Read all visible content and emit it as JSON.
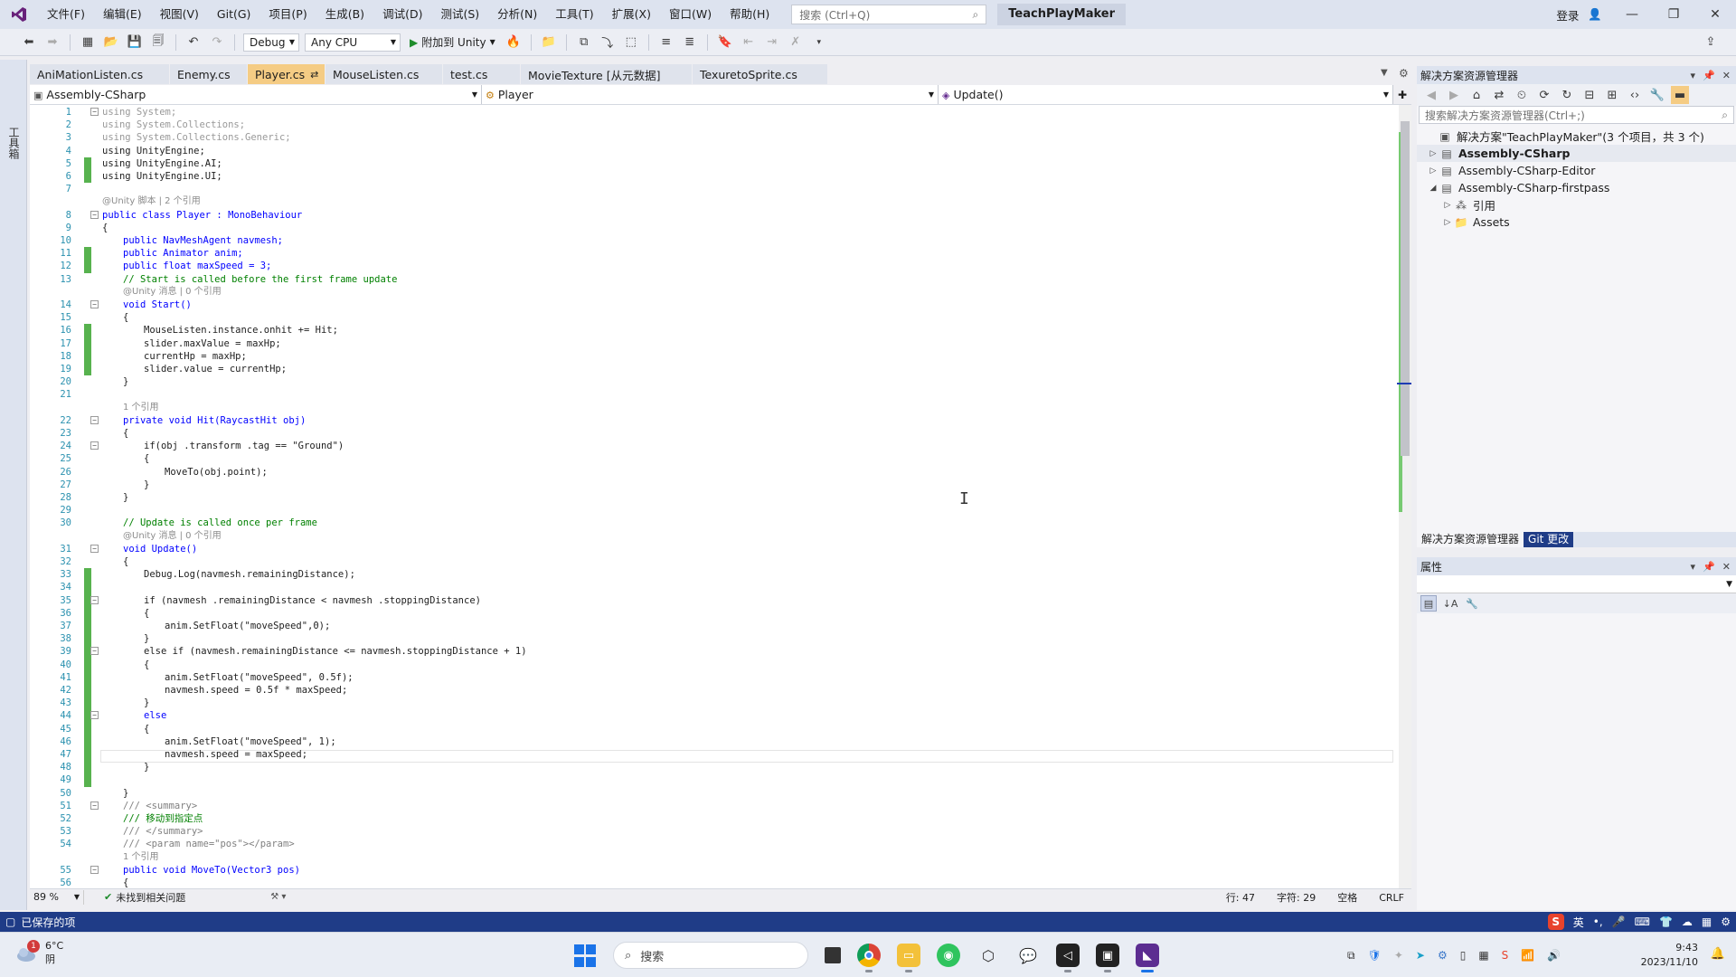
{
  "window": {
    "menus": [
      "文件(F)",
      "编辑(E)",
      "视图(V)",
      "Git(G)",
      "项目(P)",
      "生成(B)",
      "调试(D)",
      "测试(S)",
      "分析(N)",
      "工具(T)",
      "扩展(X)",
      "窗口(W)",
      "帮助(H)"
    ],
    "search_placeholder": "搜索 (Ctrl+Q)",
    "solution_name": "TeachPlayMaker",
    "signin_label": "登录"
  },
  "toolbar": {
    "config": "Debug",
    "platform": "Any CPU",
    "attach_label": "附加到 Unity"
  },
  "left_strip": {
    "toolbox_label": "工具箱"
  },
  "tabs": [
    {
      "label": "AniMationListen.cs",
      "active": false
    },
    {
      "label": "Enemy.cs",
      "active": false
    },
    {
      "label": "Player.cs",
      "active": true
    },
    {
      "label": "MouseListen.cs",
      "active": false
    },
    {
      "label": "test.cs",
      "active": false
    },
    {
      "label": "MovieTexture [从元数据]",
      "active": false
    },
    {
      "label": "TexuretoSprite.cs",
      "active": false
    }
  ],
  "navbar": {
    "project": "Assembly-CSharp",
    "class": "Player",
    "member": "Update()"
  },
  "code_lines": [
    {
      "n": "1",
      "t": "using System;",
      "k": "using",
      "i": 0,
      "f": "minus",
      "c": false
    },
    {
      "n": "2",
      "t": "using System.Collections;",
      "k": "using",
      "i": 0,
      "f": "",
      "c": false
    },
    {
      "n": "3",
      "t": "using System.Collections.Generic;",
      "k": "using",
      "i": 0,
      "f": "",
      "c": false
    },
    {
      "n": "4",
      "t": "using UnityEngine;",
      "k": "code",
      "i": 0,
      "f": "",
      "c": false
    },
    {
      "n": "5",
      "t": "using UnityEngine.AI;",
      "k": "code",
      "i": 0,
      "f": "",
      "c": true
    },
    {
      "n": "6",
      "t": "using UnityEngine.UI;",
      "k": "code",
      "i": 0,
      "f": "",
      "c": true
    },
    {
      "n": "7",
      "t": "",
      "k": "code",
      "i": 0,
      "f": "",
      "c": false
    },
    {
      "n": "",
      "t": "@Unity 脚本 | 2 个引用",
      "k": "lens",
      "i": 0,
      "f": "",
      "c": false
    },
    {
      "n": "8",
      "t": "public class Player : MonoBehaviour",
      "k": "kw",
      "i": 0,
      "f": "minus",
      "c": false
    },
    {
      "n": "9",
      "t": "{",
      "k": "code",
      "i": 0,
      "f": "",
      "c": false
    },
    {
      "n": "10",
      "t": "public NavMeshAgent navmesh;",
      "k": "kw",
      "i": 1,
      "f": "",
      "c": false
    },
    {
      "n": "11",
      "t": "public Animator anim;",
      "k": "kw",
      "i": 1,
      "f": "",
      "c": true
    },
    {
      "n": "12",
      "t": "public float maxSpeed = 3;",
      "k": "kw",
      "i": 1,
      "f": "",
      "c": true
    },
    {
      "n": "13",
      "t": "// Start is called before the first frame update",
      "k": "comment",
      "i": 1,
      "f": "",
      "c": false
    },
    {
      "n": "",
      "t": "@Unity 消息 | 0 个引用",
      "k": "lens",
      "i": 1,
      "f": "",
      "c": false
    },
    {
      "n": "14",
      "t": "void Start()",
      "k": "kw",
      "i": 1,
      "f": "minus",
      "c": false
    },
    {
      "n": "15",
      "t": "{",
      "k": "code",
      "i": 1,
      "f": "",
      "c": false
    },
    {
      "n": "16",
      "t": "MouseListen.instance.onhit += Hit;",
      "k": "code",
      "i": 2,
      "f": "",
      "c": true
    },
    {
      "n": "17",
      "t": "slider.maxValue = maxHp;",
      "k": "code",
      "i": 2,
      "f": "",
      "c": true
    },
    {
      "n": "18",
      "t": "currentHp = maxHp;",
      "k": "code",
      "i": 2,
      "f": "",
      "c": true
    },
    {
      "n": "19",
      "t": "slider.value = currentHp;",
      "k": "code",
      "i": 2,
      "f": "",
      "c": true
    },
    {
      "n": "20",
      "t": "}",
      "k": "code",
      "i": 1,
      "f": "",
      "c": false
    },
    {
      "n": "21",
      "t": "",
      "k": "code",
      "i": 0,
      "f": "",
      "c": false
    },
    {
      "n": "",
      "t": "1 个引用",
      "k": "lens",
      "i": 1,
      "f": "",
      "c": false
    },
    {
      "n": "22",
      "t": "private void Hit(RaycastHit obj)",
      "k": "kw",
      "i": 1,
      "f": "minus",
      "c": false
    },
    {
      "n": "23",
      "t": "{",
      "k": "code",
      "i": 1,
      "f": "",
      "c": false
    },
    {
      "n": "24",
      "t": "if(obj .transform .tag == \"Ground\")",
      "k": "code",
      "i": 2,
      "f": "minus",
      "c": false
    },
    {
      "n": "25",
      "t": "{",
      "k": "code",
      "i": 2,
      "f": "",
      "c": false
    },
    {
      "n": "26",
      "t": "MoveTo(obj.point);",
      "k": "code",
      "i": 3,
      "f": "",
      "c": false
    },
    {
      "n": "27",
      "t": "}",
      "k": "code",
      "i": 2,
      "f": "",
      "c": false
    },
    {
      "n": "28",
      "t": "}",
      "k": "code",
      "i": 1,
      "f": "",
      "c": false
    },
    {
      "n": "29",
      "t": "",
      "k": "code",
      "i": 0,
      "f": "",
      "c": false
    },
    {
      "n": "30",
      "t": "// Update is called once per frame",
      "k": "comment",
      "i": 1,
      "f": "",
      "c": false
    },
    {
      "n": "",
      "t": "@Unity 消息 | 0 个引用",
      "k": "lens",
      "i": 1,
      "f": "",
      "c": false
    },
    {
      "n": "31",
      "t": "void Update()",
      "k": "kw",
      "i": 1,
      "f": "minus",
      "c": false
    },
    {
      "n": "32",
      "t": "{",
      "k": "code",
      "i": 1,
      "f": "",
      "c": false
    },
    {
      "n": "33",
      "t": "Debug.Log(navmesh.remainingDistance);",
      "k": "code",
      "i": 2,
      "f": "",
      "c": true
    },
    {
      "n": "34",
      "t": "",
      "k": "code",
      "i": 0,
      "f": "",
      "c": true
    },
    {
      "n": "35",
      "t": "if (navmesh .remainingDistance < navmesh .stoppingDistance)",
      "k": "code",
      "i": 2,
      "f": "minus",
      "c": true
    },
    {
      "n": "36",
      "t": "{",
      "k": "code",
      "i": 2,
      "f": "",
      "c": true
    },
    {
      "n": "37",
      "t": "anim.SetFloat(\"moveSpeed\",0);",
      "k": "code",
      "i": 3,
      "f": "",
      "c": true
    },
    {
      "n": "38",
      "t": "}",
      "k": "code",
      "i": 2,
      "f": "",
      "c": true
    },
    {
      "n": "39",
      "t": "else if (navmesh.remainingDistance <= navmesh.stoppingDistance + 1)",
      "k": "code",
      "i": 2,
      "f": "minus",
      "c": true
    },
    {
      "n": "40",
      "t": "{",
      "k": "code",
      "i": 2,
      "f": "",
      "c": true
    },
    {
      "n": "41",
      "t": "anim.SetFloat(\"moveSpeed\", 0.5f);",
      "k": "code",
      "i": 3,
      "f": "",
      "c": true
    },
    {
      "n": "42",
      "t": "navmesh.speed = 0.5f * maxSpeed;",
      "k": "code",
      "i": 3,
      "f": "",
      "c": true
    },
    {
      "n": "43",
      "t": "}",
      "k": "code",
      "i": 2,
      "f": "",
      "c": true
    },
    {
      "n": "44",
      "t": "else",
      "k": "kw",
      "i": 2,
      "f": "minus",
      "c": true
    },
    {
      "n": "45",
      "t": "{",
      "k": "code",
      "i": 2,
      "f": "",
      "c": true
    },
    {
      "n": "46",
      "t": "anim.SetFloat(\"moveSpeed\", 1);",
      "k": "code",
      "i": 3,
      "f": "",
      "c": true
    },
    {
      "n": "47",
      "t": "navmesh.speed = maxSpeed;",
      "k": "code",
      "i": 3,
      "f": "",
      "c": true
    },
    {
      "n": "48",
      "t": "}",
      "k": "code",
      "i": 2,
      "f": "",
      "c": true
    },
    {
      "n": "49",
      "t": "",
      "k": "code",
      "i": 0,
      "f": "",
      "c": true
    },
    {
      "n": "50",
      "t": "}",
      "k": "code",
      "i": 1,
      "f": "",
      "c": false
    },
    {
      "n": "51",
      "t": "/// <summary>",
      "k": "doc",
      "i": 1,
      "f": "minus",
      "c": false
    },
    {
      "n": "52",
      "t": "/// 移动到指定点",
      "k": "docgreen",
      "i": 1,
      "f": "",
      "c": false
    },
    {
      "n": "53",
      "t": "/// </summary>",
      "k": "doc",
      "i": 1,
      "f": "",
      "c": false
    },
    {
      "n": "54",
      "t": "/// <param name=\"pos\"></param>",
      "k": "doc",
      "i": 1,
      "f": "",
      "c": false
    },
    {
      "n": "",
      "t": "1 个引用",
      "k": "lens",
      "i": 1,
      "f": "",
      "c": false
    },
    {
      "n": "55",
      "t": "public void MoveTo(Vector3 pos)",
      "k": "kw",
      "i": 1,
      "f": "minus",
      "c": false
    },
    {
      "n": "56",
      "t": "{",
      "k": "code",
      "i": 1,
      "f": "",
      "c": false
    }
  ],
  "editor_status": {
    "zoom": "89 %",
    "issues": "未找到相关问题",
    "line": "行: 47",
    "char": "字符: 29",
    "whitespace": "空格",
    "eol": "CRLF"
  },
  "solution_explorer": {
    "title": "解决方案资源管理器",
    "search_placeholder": "搜索解决方案资源管理器(Ctrl+;)",
    "items": [
      {
        "label": "解决方案\"TeachPlayMaker\"(3 个项目，共 3 个)",
        "depth": 0,
        "twisty": "",
        "icon": "solution-icon",
        "bold": false,
        "selected": false
      },
      {
        "label": "Assembly-CSharp",
        "depth": 1,
        "twisty": "▷",
        "icon": "csharp-project-icon",
        "bold": true,
        "selected": true
      },
      {
        "label": "Assembly-CSharp-Editor",
        "depth": 1,
        "twisty": "▷",
        "icon": "csharp-project-icon",
        "bold": false,
        "selected": false
      },
      {
        "label": "Assembly-CSharp-firstpass",
        "depth": 1,
        "twisty": "◢",
        "icon": "csharp-project-icon",
        "bold": false,
        "selected": false
      },
      {
        "label": "引用",
        "depth": 2,
        "twisty": "▷",
        "icon": "references-icon",
        "bold": false,
        "selected": false
      },
      {
        "label": "Assets",
        "depth": 2,
        "twisty": "▷",
        "icon": "folder-icon",
        "bold": false,
        "selected": false
      }
    ],
    "tab_solution": "解决方案资源管理器",
    "tab_git": "Git 更改"
  },
  "properties": {
    "title": "属性"
  },
  "app_status": {
    "text": "已保存的项",
    "ime_lang": "英"
  },
  "taskbar": {
    "weather_temp": "6°C",
    "weather_desc": "阴",
    "weather_badge": "1",
    "search_label": "搜索",
    "time": "9:43",
    "date": "2023/11/10"
  },
  "colors": {
    "title_bg": "#dde3ef",
    "active_tab": "#f5cc84",
    "status_bar": "#1f3c87",
    "keyword": "#0000ff",
    "comment": "#008000",
    "line_number": "#2b91af",
    "change_margin": "#57b24e"
  }
}
